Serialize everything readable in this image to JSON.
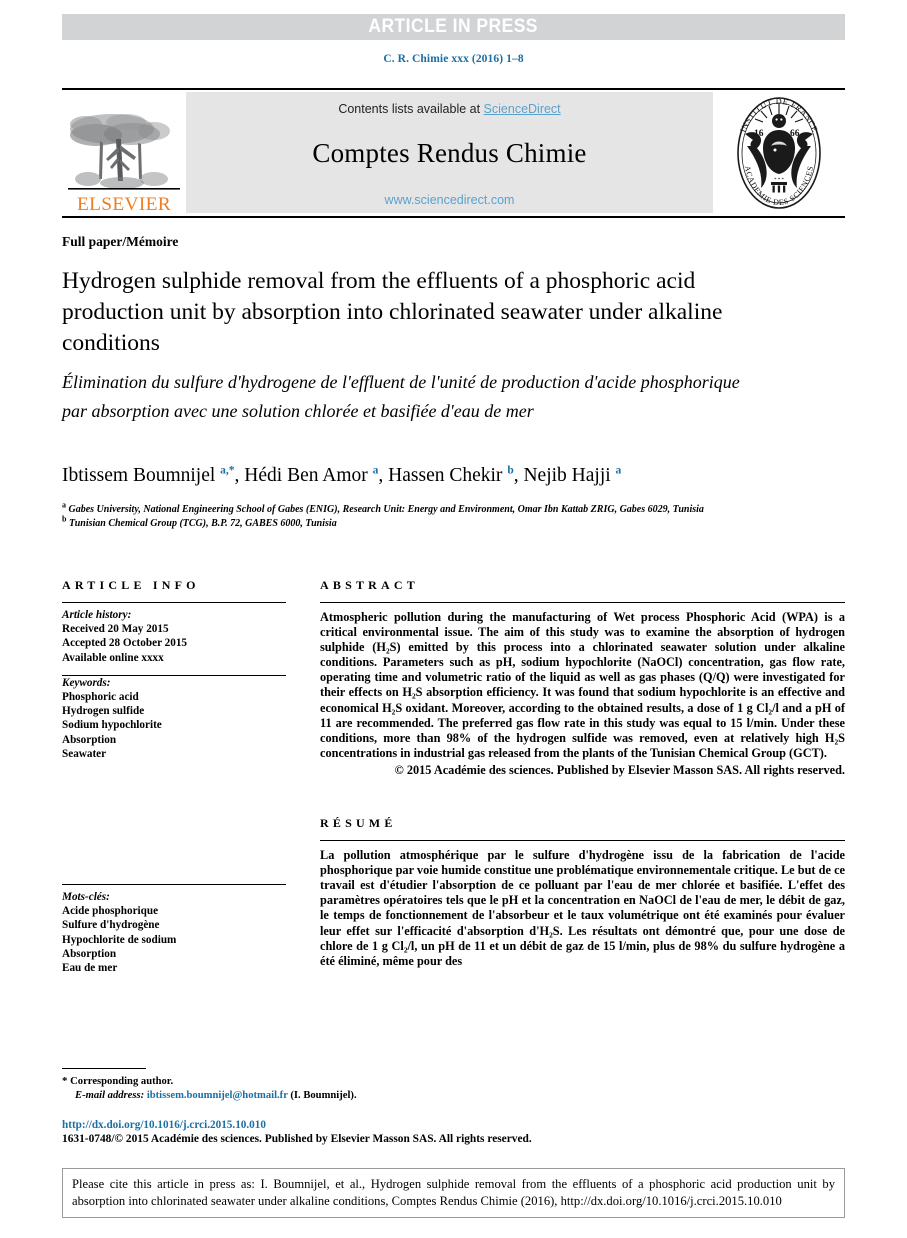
{
  "banner": {
    "press_label": "ARTICLE IN PRESS",
    "journal_ref": "C. R. Chimie xxx (2016) 1–8",
    "banner_bg": "#d2d3d5",
    "link_blue": "#1a6fa5",
    "sd_blue": "#5aa2cd",
    "elsevier_orange": "#ef7d22"
  },
  "masthead": {
    "publisher_word": "ELSEVIER",
    "contents_prefix": "Contents lists available at ",
    "contents_link": "ScienceDirect",
    "journal_title": "Comptes Rendus Chimie",
    "journal_url": "www.sciencedirect.com",
    "seal_outer_top": "INSTITUT DE FRANCE",
    "seal_outer_bottom": "ACADÉMIE DES SCIENCES",
    "seal_year": "1666"
  },
  "article": {
    "paper_type": "Full paper/Mémoire",
    "title_en": "Hydrogen sulphide removal from the effluents of a phosphoric acid production unit by absorption into chlorinated seawater under alkaline conditions",
    "title_fr": "Élimination du sulfure d'hydrogene de l'effluent de l'unité de production d'acide phosphorique par absorption avec une solution chlorée et basifiée d'eau de mer",
    "authors": [
      {
        "name": "Ibtissem Boumnijel",
        "marks": "a,*"
      },
      {
        "name": "Hédi Ben Amor",
        "marks": "a"
      },
      {
        "name": "Hassen Chekir",
        "marks": "b"
      },
      {
        "name": "Nejib Hajji",
        "marks": "a"
      }
    ],
    "affiliations": [
      {
        "mark": "a",
        "text": "Gabes University, National Engineering School of Gabes (ENIG), Research Unit: Energy and Environment, Omar Ibn Kattab ZRIG, Gabes 6029, Tunisia"
      },
      {
        "mark": "b",
        "text": "Tunisian Chemical Group (TCG), B.P. 72, GABES 6000, Tunisia"
      }
    ]
  },
  "article_info": {
    "heading": "ARTICLE INFO",
    "history_label": "Article history:",
    "history": [
      "Received 20 May 2015",
      "Accepted 28 October 2015",
      "Available online xxxx"
    ],
    "keywords_label": "Keywords:",
    "keywords": [
      "Phosphoric acid",
      "Hydrogen sulfide",
      "Sodium hypochlorite",
      "Absorption",
      "Seawater"
    ],
    "motscles_label": "Mots-clés:",
    "motscles": [
      "Acide phosphorique",
      "Sulfure d'hydrogène",
      "Hypochlorite de sodium",
      "Absorption",
      "Eau de mer"
    ]
  },
  "abstract": {
    "heading": "ABSTRACT",
    "body": "Atmospheric pollution during the manufacturing of Wet process Phosphoric Acid (WPA) is a critical environmental issue. The aim of this study was to examine the absorption of hydrogen sulphide (H₂S) emitted by this process into a chlorinated seawater solution under alkaline conditions. Parameters such as pH, sodium hypochlorite (NaOCl) concentration, gas flow rate, operating time and volumetric ratio of the liquid as well as gas phases (Q/Q) were investigated for their effects on H₂S absorption efficiency. It was found that sodium hypochlorite is an effective and economical H₂S oxidant. Moreover, according to the obtained results, a dose of 1 g Cl₂/l and a pH of 11 are recommended. The preferred gas flow rate in this study was equal to 15 l/min. Under these conditions, more than 98% of the hydrogen sulfide was removed, even at relatively high H₂S concentrations in industrial gas released from the plants of the Tunisian Chemical Group (GCT).",
    "copyright": "© 2015 Académie des sciences. Published by Elsevier Masson SAS. All rights reserved."
  },
  "resume": {
    "heading": "RÉSUMÉ",
    "body": "La pollution atmosphérique par le sulfure d'hydrogène issu de la fabrication de l'acide phosphorique par voie humide constitue une problématique environnementale critique. Le but de ce travail est d'étudier l'absorption de ce polluant par l'eau de mer chlorée et basifiée. L'effet des paramètres opératoires tels que le pH et la concentration en NaOCl de l'eau de mer, le débit de gaz, le temps de fonctionnement de l'absorbeur et le taux volumétrique ont été examinés pour évaluer leur effet sur l'efficacité d'absorption d'H₂S. Les résultats ont démontré que, pour une dose de chlore de 1 g Cl₂/l, un pH de 11 et un débit de gaz de 15 l/min, plus de 98% du sulfure hydrogène a été éliminé, même pour des"
  },
  "footer": {
    "corresponding_star": "*",
    "corresponding_label": "Corresponding author.",
    "email_label": "E-mail address:",
    "email": "ibtissem.boumnijel@hotmail.fr",
    "email_suffix": "(I. Boumnijel).",
    "doi_url": "http://dx.doi.org/10.1016/j.crci.2015.10.010",
    "issn_line": "1631-0748/© 2015 Académie des sciences. Published by Elsevier Masson SAS. All rights reserved.",
    "citation": "Please cite this article in press as: I. Boumnijel, et al., Hydrogen sulphide removal from the effluents of a phosphoric acid production unit by absorption into chlorinated seawater under alkaline conditions, Comptes Rendus Chimie (2016), http://dx.doi.org/10.1016/j.crci.2015.10.010"
  }
}
